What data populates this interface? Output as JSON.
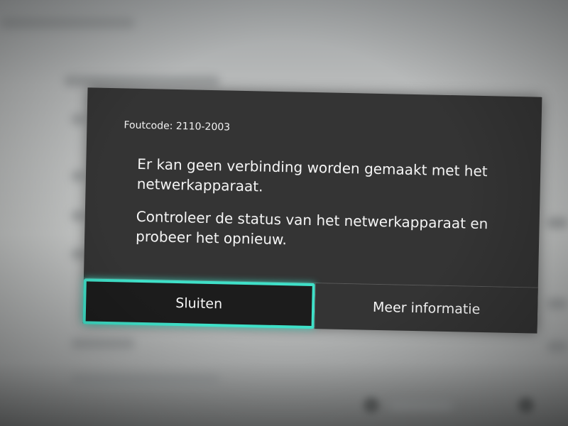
{
  "dialog": {
    "error_code": "Foutcode: 2110-2003",
    "message_line_1": "Er kan geen verbinding worden gemaakt met het netwerkapparaat.",
    "message_line_2": "Controleer de status van het netwerkapparaat en probeer het opnieuw.",
    "buttons": {
      "close_label": "Sluiten",
      "more_info_label": "Meer informatie"
    }
  },
  "colors": {
    "dialog_background": "#343434",
    "focus_highlight": "#3fe0c8",
    "text": "#f5f5f5"
  }
}
